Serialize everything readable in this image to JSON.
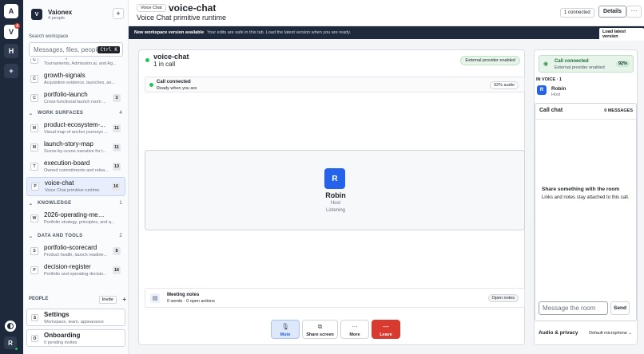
{
  "rail": {
    "workspaces": [
      {
        "letter": "A"
      },
      {
        "letter": "V",
        "badge": "4"
      },
      {
        "letter": "H"
      }
    ],
    "add": "+",
    "me": "R"
  },
  "sidebar": {
    "ws_logo": "V",
    "ws_name": "Vaionex",
    "ws_members": "4 people",
    "add": "+",
    "search_label": "Search workspace",
    "search_placeholder": "Messages, files, people",
    "search_shortcut": "Ctrl K",
    "top_items": [
      {
        "icon": "C",
        "title": "anchor-products",
        "sub": "Tournaments, Admission.ai, and Ag..."
      },
      {
        "icon": "C",
        "title": "growth-signals",
        "sub": "Acquisition evidence, launches, an..."
      },
      {
        "icon": "C",
        "title": "portfolio-launch",
        "sub": "Cross-functional launch room ...",
        "count": "3"
      }
    ],
    "sections": [
      {
        "label": "WORK SURFACES",
        "count": "4",
        "items": [
          {
            "icon": "M",
            "title": "product-ecosystem-...",
            "sub": "Visual map of anchor journeys ...",
            "count": "11"
          },
          {
            "icon": "M",
            "title": "launch-story-map",
            "sub": "Scene-by-scene narrative for t...",
            "count": "11"
          },
          {
            "icon": "T",
            "title": "execution-board",
            "sub": "Owned commitments and relea...",
            "count": "13"
          },
          {
            "icon": "P",
            "title": "voice-chat",
            "sub": "Voice Chat primitive runtime",
            "count": "16",
            "active": true
          }
        ]
      },
      {
        "label": "KNOWLEDGE",
        "count": "1",
        "items": [
          {
            "icon": "W",
            "title": "2026-operating-memo",
            "sub": "Portfolio strategy, principles, and q..."
          }
        ]
      },
      {
        "label": "DATA AND TOOLS",
        "count": "2",
        "items": [
          {
            "icon": "S",
            "title": "portfolio-scorecard",
            "sub": "Product health, launch readine...",
            "count": "8"
          },
          {
            "icon": "P",
            "title": "decision-register",
            "sub": "Portfolio and operating decisio...",
            "count": "16"
          }
        ]
      }
    ],
    "people_label": "PEOPLE",
    "invite": "Invite",
    "settings": {
      "icon": "S",
      "title": "Settings",
      "sub": "Workspace, team, appearance"
    },
    "onboarding": {
      "icon": "O",
      "title": "Onboarding",
      "sub": "0 pending invites"
    }
  },
  "header": {
    "tag": "Voice Chat",
    "title": "voice-chat",
    "subtitle": "Voice Chat primitive runtime",
    "connected": "1 connected",
    "details": "Details",
    "more": "···"
  },
  "banner": {
    "title": "New workspace version available",
    "text": "Your edits are safe in this tab. Load the latest version when you are ready.",
    "button": "Load latest version"
  },
  "stage": {
    "name": "voice-chat",
    "sub": "1 in call",
    "provider": "External provider enabled",
    "call_title": "Call connected",
    "call_sub": "Ready when you are",
    "audio": "92% audio",
    "participant": {
      "initial": "R",
      "name": "Robin",
      "role": "Host",
      "state": "Listening"
    },
    "notes_title": "Meeting notes",
    "notes_sub": "0 words · 0 open actions",
    "notes_btn": "Open notes",
    "controls": [
      {
        "icon": "mic-icon",
        "glyph": "🎙",
        "label": "Mute"
      },
      {
        "icon": "screen-share-icon",
        "glyph": "⧉",
        "label": "Share screen"
      },
      {
        "icon": "more-icon",
        "glyph": "···",
        "label": "More"
      },
      {
        "icon": "hangup-icon",
        "glyph": "—",
        "label": "Leave"
      }
    ]
  },
  "panel": {
    "status_title": "Call connected",
    "status_sub": "External provider enabled",
    "status_pct": "92%",
    "in_voice": "IN VOICE · 1",
    "member": {
      "initial": "R",
      "name": "Robin",
      "role": "Host"
    },
    "chat_title": "Call chat",
    "chat_count": "0 MESSAGES",
    "empty_title": "Share something with the room",
    "empty_text": "Links and notes stay attached to this call.",
    "msg_placeholder": "Message the room",
    "send": "Send",
    "audio_privacy": "Audio & privacy",
    "mic": "Default microphone"
  },
  "colors": {
    "rail": "#1e293b",
    "accent": "#2563eb",
    "success": "#22c55e",
    "danger": "#d93a2f"
  }
}
